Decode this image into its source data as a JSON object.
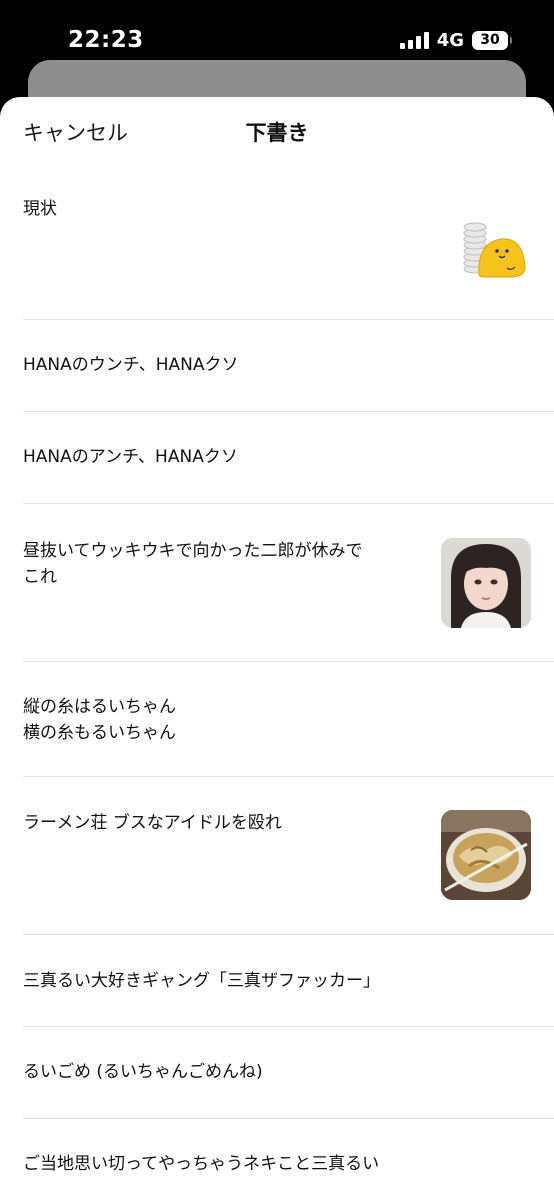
{
  "status_bar": {
    "time": "22:23",
    "network": "4G",
    "battery": "30"
  },
  "header": {
    "cancel_label": "キャンセル",
    "title": "下書き"
  },
  "drafts": [
    {
      "text": "現状",
      "thumbnail": "blob-character-with-coins"
    },
    {
      "text": "HANAのウンチ、HANAクソ"
    },
    {
      "text": "HANAのアンチ、HANAクソ"
    },
    {
      "text": "昼抜いてウッキウキで向かった二郎が休みで\nこれ",
      "thumbnail": "portrait-photo"
    },
    {
      "text": "縦の糸はるいちゃん\n横の糸もるいちゃん"
    },
    {
      "text": "ラーメン荘 ブスなアイドルを殴れ",
      "thumbnail": "ramen-bowl-photo"
    },
    {
      "text": "三真るい大好きギャング「三真ザファッカー」"
    },
    {
      "text": "るいごめ (るいちゃんごめんね)"
    },
    {
      "text": "ご当地思い切ってやっちゃうネキこと三真るい"
    }
  ],
  "colors": {
    "background": "#000000",
    "sheet": "#ffffff",
    "divider": "#e3e3e3",
    "text": "#111111"
  }
}
